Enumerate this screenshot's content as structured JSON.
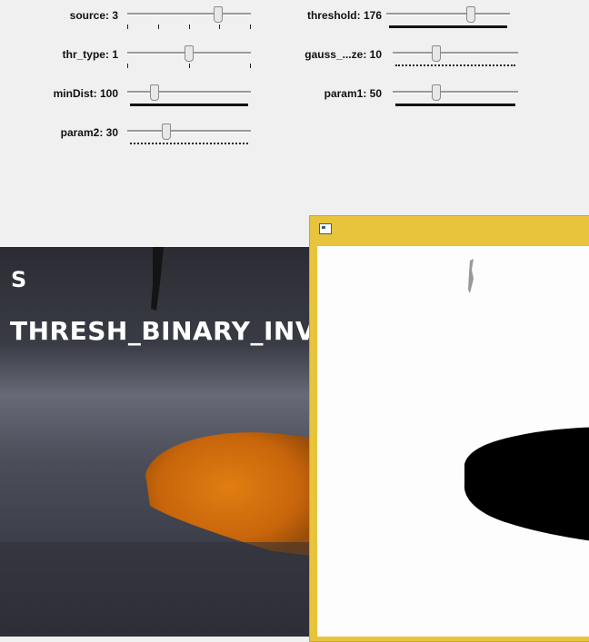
{
  "trackbars": [
    {
      "id": "source",
      "label": "source: 3",
      "value": 3,
      "min": 0,
      "max": 4
    },
    {
      "id": "thr_type",
      "label": "thr_type: 1",
      "value": 1,
      "min": 0,
      "max": 2
    },
    {
      "id": "minDist",
      "label": "minDist: 100",
      "value": 100,
      "min": 0,
      "max": 1000
    },
    {
      "id": "param2",
      "label": "param2: 30",
      "value": 30,
      "min": 0,
      "max": 100
    },
    {
      "id": "threshold",
      "label": "threshold: 176",
      "value": 176,
      "min": 0,
      "max": 255
    },
    {
      "id": "gauss_size",
      "label": "gauss_...ze: 10",
      "value": 10,
      "min": 0,
      "max": 50
    },
    {
      "id": "param1",
      "label": "param1: 50",
      "value": 50,
      "min": 0,
      "max": 200
    }
  ],
  "image_window": {
    "overlay_line1": "S",
    "overlay_line2": "THRESH_BINARY_INV"
  },
  "threshold_window": {
    "title": ""
  },
  "colors": {
    "title_bar": "#e8c33c",
    "orange_object": "#d9740f",
    "black_blob": "#000000"
  }
}
